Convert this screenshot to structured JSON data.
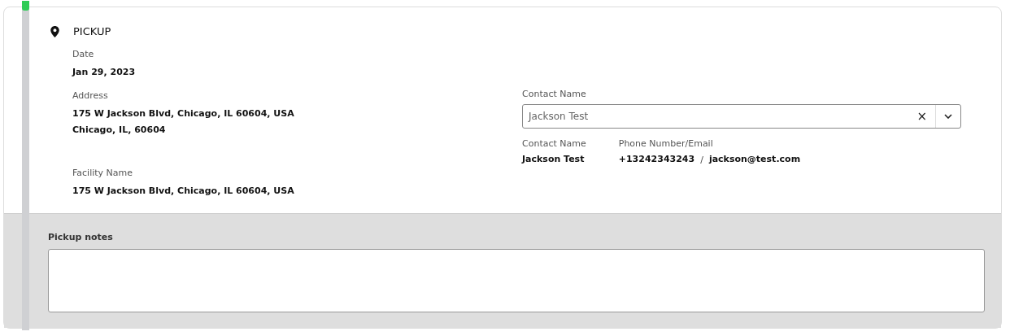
{
  "section": {
    "title": "PICKUP",
    "date": {
      "label": "Date",
      "value": "Jan 29, 2023"
    },
    "address": {
      "label": "Address",
      "lines": [
        "175 W Jackson Blvd, Chicago, IL 60604, USA",
        "Chicago, IL, 60604"
      ]
    },
    "facility": {
      "label": "Facility Name",
      "value": "175 W Jackson Blvd, Chicago, IL 60604, USA"
    },
    "contact_select": {
      "label": "Contact Name",
      "value": "Jackson Test",
      "clear": "×"
    },
    "contact_details": [
      {
        "label": "Contact Name",
        "value": "Jackson Test"
      },
      {
        "label": "Phone Number/Email",
        "phone": "+13242343243",
        "separator": "/",
        "email": "jackson@test.com"
      }
    ]
  },
  "notes": {
    "label": "Pickup notes"
  }
}
